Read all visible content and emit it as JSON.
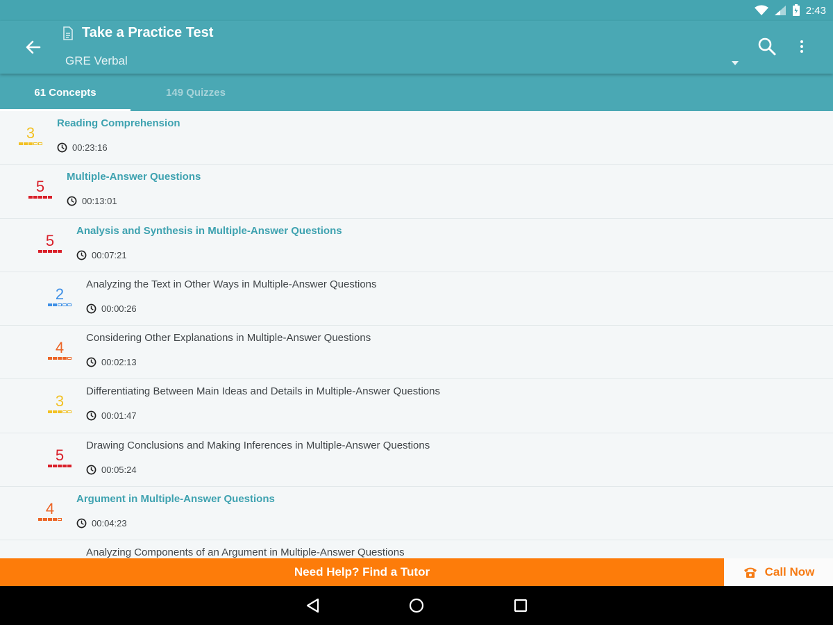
{
  "status_bar": {
    "time": "2:43"
  },
  "app_bar": {
    "title": "Take a Practice Test",
    "subtitle": "GRE Verbal"
  },
  "tabs": [
    {
      "label": "61 Concepts",
      "active": true
    },
    {
      "label": "149 Quizzes",
      "active": false
    }
  ],
  "colors": {
    "primary": "#4aa8b4",
    "accent_orange": "#fd7c0a",
    "level_yellow": "#f2c124",
    "level_red": "#d9202a",
    "level_blue": "#3d8fe6",
    "level_orange": "#ec6526"
  },
  "concepts": [
    {
      "title": "Reading Comprehension",
      "time": "00:23:16",
      "level": "3",
      "color": "#f2c124",
      "filled": 3,
      "indent": 0,
      "link": true
    },
    {
      "title": "Multiple-Answer Questions",
      "time": "00:13:01",
      "level": "5",
      "color": "#d9202a",
      "filled": 5,
      "indent": 1,
      "link": true
    },
    {
      "title": "Analysis and Synthesis in Multiple-Answer Questions",
      "time": "00:07:21",
      "level": "5",
      "color": "#d9202a",
      "filled": 5,
      "indent": 2,
      "link": true
    },
    {
      "title": "Analyzing the Text in Other Ways in Multiple-Answer Questions",
      "time": "00:00:26",
      "level": "2",
      "color": "#3d8fe6",
      "filled": 2,
      "indent": 3,
      "link": false
    },
    {
      "title": "Considering Other Explanations in Multiple-Answer Questions",
      "time": "00:02:13",
      "level": "4",
      "color": "#ec6526",
      "filled": 4,
      "indent": 3,
      "link": false
    },
    {
      "title": "Differentiating Between Main Ideas and Details in Multiple-Answer Questions",
      "time": "00:01:47",
      "level": "3",
      "color": "#f2c124",
      "filled": 3,
      "indent": 3,
      "link": false
    },
    {
      "title": "Drawing Conclusions and Making Inferences in Multiple-Answer Questions",
      "time": "00:05:24",
      "level": "5",
      "color": "#d9202a",
      "filled": 5,
      "indent": 3,
      "link": false
    },
    {
      "title": "Argument in Multiple-Answer Questions",
      "time": "00:04:23",
      "level": "4",
      "color": "#ec6526",
      "filled": 4,
      "indent": 2,
      "link": true
    },
    {
      "title": "Analyzing Components of an Argument in Multiple-Answer Questions",
      "time": "",
      "level": "",
      "color": "#ec6526",
      "filled": 0,
      "indent": 3,
      "link": false
    }
  ],
  "banner": {
    "help_label": "Need Help? Find a Tutor",
    "call_label": "Call Now"
  },
  "icons": {
    "back": "arrow-left-icon",
    "doc": "document-icon",
    "search": "search-icon",
    "more": "more-vert-icon",
    "clock": "clock-icon",
    "phone": "phone-icon"
  }
}
